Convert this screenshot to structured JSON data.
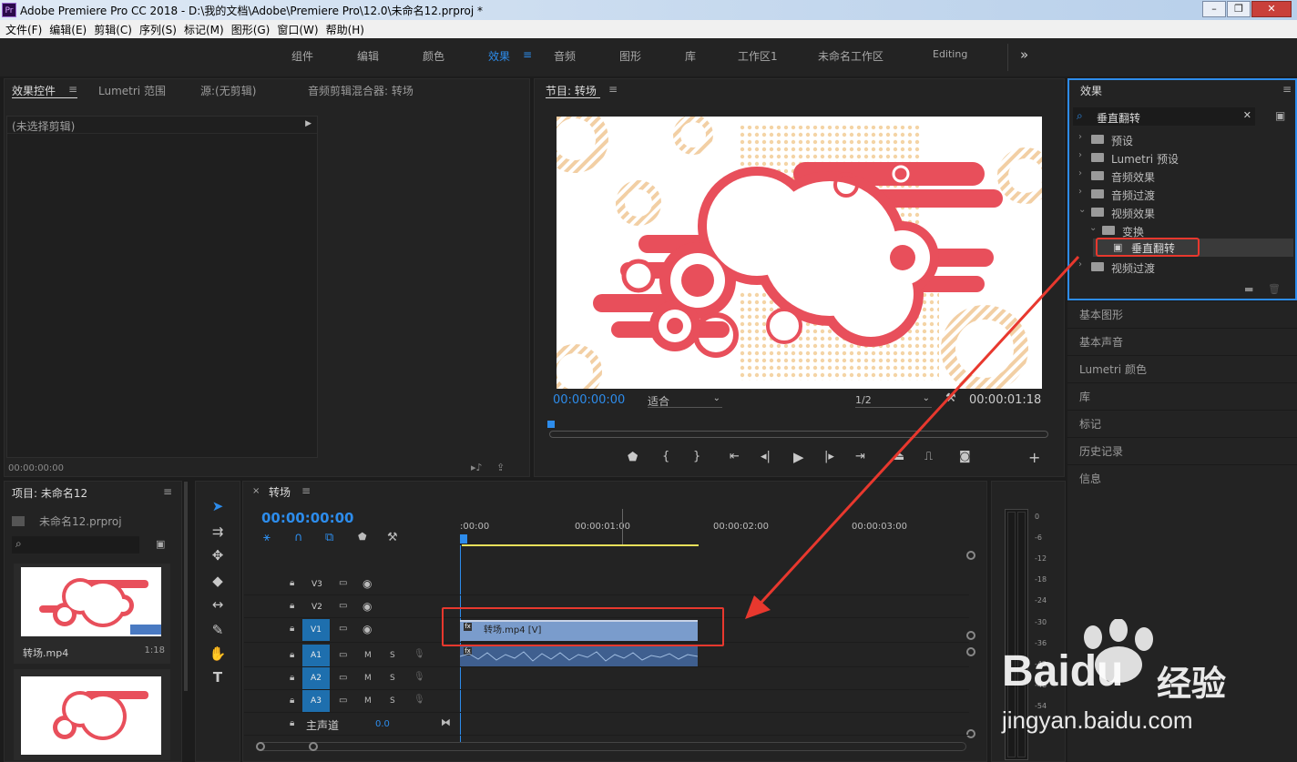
{
  "app": {
    "title": "Adobe Premiere Pro CC 2018 - D:\\我的文档\\Adobe\\Premiere Pro\\12.0\\未命名12.prproj *",
    "icon_text": "Pr",
    "min": "–",
    "max": "❐",
    "close": "✕"
  },
  "menu": [
    "文件(F)",
    "编辑(E)",
    "剪辑(C)",
    "序列(S)",
    "标记(M)",
    "图形(G)",
    "窗口(W)",
    "帮助(H)"
  ],
  "workspaces": {
    "tabs": [
      "组件",
      "编辑",
      "颜色",
      "效果",
      "音频",
      "图形",
      "库",
      "工作区1",
      "未命名工作区",
      "Editing"
    ],
    "active": "效果",
    "more": "»"
  },
  "source_panel": {
    "tabs": [
      "效果控件",
      "Lumetri 范围",
      "源:(无剪辑)",
      "音频剪辑混合器: 转场"
    ],
    "no_clip": "(未选择剪辑)",
    "timecode": "00:00:00:00"
  },
  "program": {
    "title": "节目: 转场",
    "tc_current": "00:00:00:00",
    "fit": "适合",
    "res": "1/2",
    "tc_total": "00:00:01:18"
  },
  "effects": {
    "title": "效果",
    "search_value": "垂直翻转",
    "tree": [
      {
        "label": "预设",
        "depth": 0
      },
      {
        "label": "Lumetri 预设",
        "depth": 0
      },
      {
        "label": "音频效果",
        "depth": 0
      },
      {
        "label": "音频过渡",
        "depth": 0
      },
      {
        "label": "视频效果",
        "depth": 0,
        "open": true
      },
      {
        "label": "变换",
        "depth": 1,
        "open": true
      },
      {
        "label": "垂直翻转",
        "depth": 2,
        "selected": true
      },
      {
        "label": "视频过渡",
        "depth": 0
      }
    ]
  },
  "side_panels": [
    "基本图形",
    "基本声音",
    "Lumetri 颜色",
    "库",
    "标记",
    "历史记录",
    "信息"
  ],
  "project": {
    "title": "项目: 未命名12",
    "file": "未命名12.prproj",
    "item_name": "转场.mp4",
    "item_duration": "1:18"
  },
  "timeline": {
    "title": "转场",
    "timecode": "00:00:00:00",
    "ruler": [
      ":00:00",
      "00:00:01:00",
      "00:00:02:00",
      "00:00:03:00"
    ],
    "tracks": [
      {
        "name": "V3",
        "type": "video"
      },
      {
        "name": "V2",
        "type": "video"
      },
      {
        "name": "V1",
        "type": "video",
        "target": true
      },
      {
        "name": "A1",
        "type": "audio",
        "target": true
      },
      {
        "name": "A2",
        "type": "audio",
        "target": true
      },
      {
        "name": "A3",
        "type": "audio",
        "target": true
      }
    ],
    "master_label": "主声道",
    "master_value": "0.0",
    "clip_label": "转场.mp4 [V]",
    "m": "M",
    "s": "S"
  },
  "meter_ticks": [
    "0",
    "-6",
    "-12",
    "-18",
    "-24",
    "-30",
    "-36",
    "-42",
    "-48",
    "-54"
  ],
  "watermark": {
    "brand": "Bai",
    "brand2": "du",
    "cn": "经验",
    "url": "jingyan.baidu.com"
  },
  "colors": {
    "accent": "#2d8ceb",
    "highlight_red": "#e8382e",
    "clip_blue": "#7a9ccc"
  }
}
